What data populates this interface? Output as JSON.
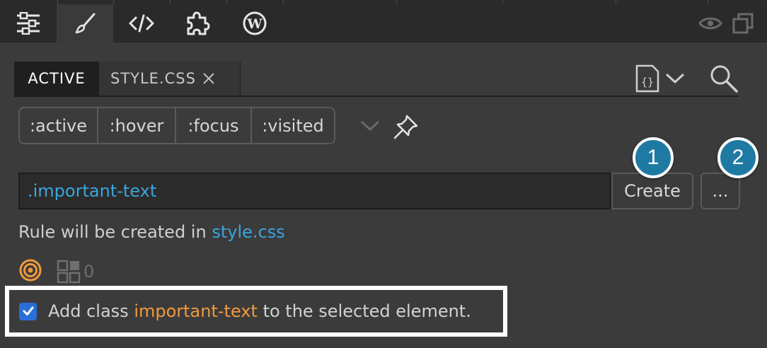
{
  "toolbar": {
    "icons": [
      "sliders-icon",
      "brush-icon",
      "code-icon",
      "puzzle-icon",
      "wordpress-icon"
    ],
    "right_icons": [
      "eye-icon",
      "duplicate-icon"
    ]
  },
  "tabs": {
    "active_label": "ACTIVE",
    "style_label": "STYLE.CSS"
  },
  "states": [
    ":active",
    ":hover",
    ":focus",
    ":visited"
  ],
  "rule": {
    "selector": ".important-text",
    "create_label": "Create",
    "more_label": "...",
    "info_prefix": "Rule will be created in",
    "info_file": "style.css"
  },
  "callouts": [
    "1",
    "2"
  ],
  "specificity": {
    "count": "0"
  },
  "add_class": {
    "checked": true,
    "prefix": "Add class",
    "class_name": "important-text",
    "suffix": "to the selected element."
  },
  "colors": {
    "accent_blue": "#3aa5dd",
    "accent_orange": "#f09a3e",
    "checkbox": "#2a6fd8",
    "callout": "#1e7aa3"
  }
}
